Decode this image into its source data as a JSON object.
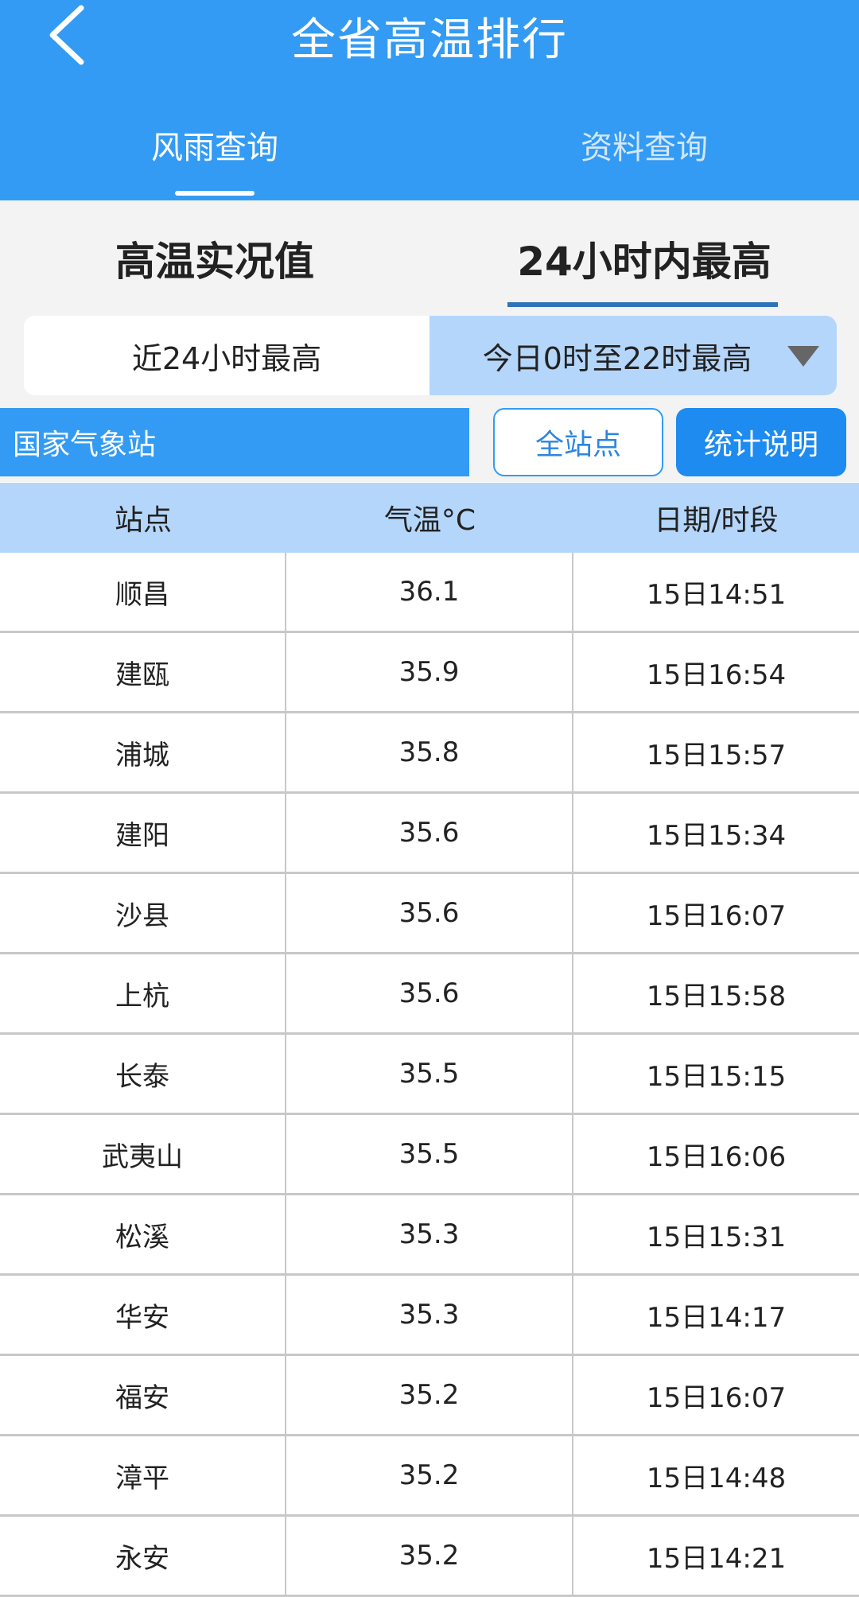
{
  "header": {
    "title": "全省高温排行",
    "back_icon": "chevron-left-icon",
    "tabs": [
      {
        "label": "风雨查询"
      },
      {
        "label": "资料查询"
      }
    ]
  },
  "modes": [
    {
      "label": "高温实况值"
    },
    {
      "label": "24小时内最高"
    }
  ],
  "segments": [
    {
      "label": "近24小时最高"
    },
    {
      "label": "今日0时至22时最高"
    }
  ],
  "filters": {
    "station_type": "国家气象站",
    "all_stations": "全站点",
    "stats_help": "统计说明"
  },
  "table": {
    "columns": [
      "站点",
      "气温°C",
      "日期/时段"
    ],
    "rows": [
      [
        "顺昌",
        "36.1",
        "15日14:51"
      ],
      [
        "建瓯",
        "35.9",
        "15日16:54"
      ],
      [
        "浦城",
        "35.8",
        "15日15:57"
      ],
      [
        "建阳",
        "35.6",
        "15日15:34"
      ],
      [
        "沙县",
        "35.6",
        "15日16:07"
      ],
      [
        "上杭",
        "35.6",
        "15日15:58"
      ],
      [
        "长泰",
        "35.5",
        "15日15:15"
      ],
      [
        "武夷山",
        "35.5",
        "15日16:06"
      ],
      [
        "松溪",
        "35.3",
        "15日15:31"
      ],
      [
        "华安",
        "35.3",
        "15日14:17"
      ],
      [
        "福安",
        "35.2",
        "15日16:07"
      ],
      [
        "漳平",
        "35.2",
        "15日14:48"
      ],
      [
        "永安",
        "35.2",
        "15日14:21"
      ]
    ]
  },
  "colors": {
    "header_bg": "#339bf3",
    "accent": "#1e8bf0",
    "light_blue": "#b5d6fb",
    "underline": "#2f74bb"
  }
}
